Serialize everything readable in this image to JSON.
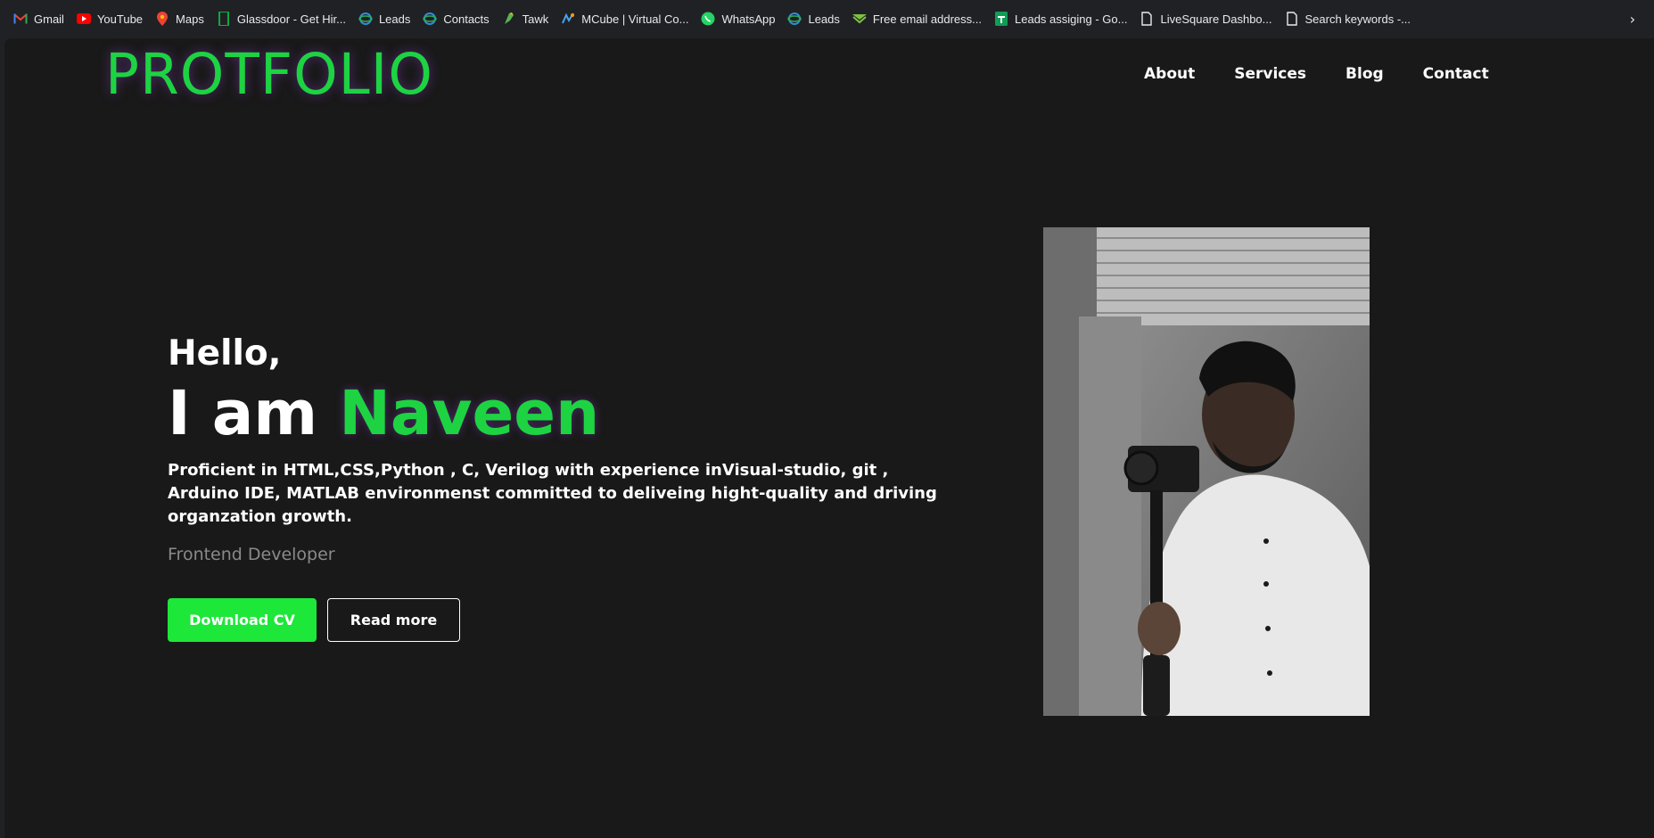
{
  "bookmarks": [
    {
      "label": "Gmail",
      "icon": "gmail-icon"
    },
    {
      "label": "YouTube",
      "icon": "youtube-icon"
    },
    {
      "label": "Maps",
      "icon": "maps-icon"
    },
    {
      "label": "Glassdoor - Get Hir...",
      "icon": "glassdoor-icon"
    },
    {
      "label": "Leads",
      "icon": "leads-icon"
    },
    {
      "label": "Contacts",
      "icon": "contacts-icon"
    },
    {
      "label": "Tawk",
      "icon": "tawk-icon"
    },
    {
      "label": "MCube | Virtual Co...",
      "icon": "mcube-icon"
    },
    {
      "label": "WhatsApp",
      "icon": "whatsapp-icon"
    },
    {
      "label": "Leads",
      "icon": "leads-icon"
    },
    {
      "label": "Free email address...",
      "icon": "email-icon"
    },
    {
      "label": "Leads assiging - Go...",
      "icon": "sheets-icon"
    },
    {
      "label": "LiveSquare Dashbo...",
      "icon": "document-icon"
    },
    {
      "label": "Search keywords -...",
      "icon": "document-icon"
    }
  ],
  "site": {
    "brand": "PROTFOLIO",
    "nav": [
      "About",
      "Services",
      "Blog",
      "Contact"
    ]
  },
  "hero": {
    "greeting": "Hello,",
    "iam": "I am ",
    "name": "Naveen",
    "description": "Proficient in HTML,CSS,Python , C, Verilog with experience inVisual-studio, git , Arduino IDE, MATLAB environmenst committed to deliveing hight-quality and driving organzation growth.",
    "role": "Frontend Developer",
    "primary_button": "Download CV",
    "secondary_button": "Read more"
  },
  "colors": {
    "accent": "#1dd342",
    "button": "#1de739",
    "background": "#191919",
    "chrome": "#202124"
  }
}
